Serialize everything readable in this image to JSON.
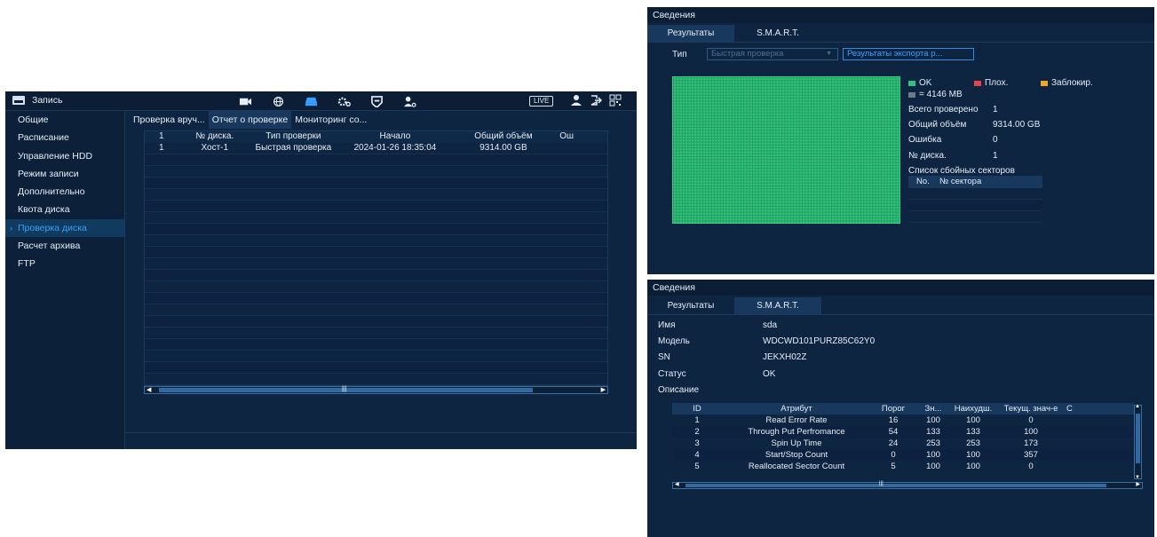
{
  "left_window": {
    "title": "Запись",
    "live_label": "LIVE",
    "sidebar": {
      "items": [
        {
          "label": "Общие",
          "active": false
        },
        {
          "label": "Расписание",
          "active": false
        },
        {
          "label": "Управление HDD",
          "active": false
        },
        {
          "label": "Режим записи",
          "active": false
        },
        {
          "label": "Дополнительно",
          "active": false
        },
        {
          "label": "Квота диска",
          "active": false
        },
        {
          "label": "Проверка диска",
          "active": true
        },
        {
          "label": "Расчет архива",
          "active": false
        },
        {
          "label": "FTP",
          "active": false
        }
      ]
    },
    "tabs": [
      {
        "label": "Проверка вруч...",
        "active": false
      },
      {
        "label": "Отчет о проверке",
        "active": true
      },
      {
        "label": "Мониторинг со...",
        "active": false
      }
    ],
    "table": {
      "headers": [
        "1",
        "№ диска.",
        "Тип проверки",
        "Начало",
        "Общий объём",
        "Ош"
      ],
      "rows": [
        [
          "1",
          "Хост-1",
          "Быстрая проверка",
          "2024-01-26 18:35:04",
          "9314.00 GB",
          ""
        ]
      ]
    },
    "icons": [
      "camera-icon",
      "network-icon",
      "storage-icon",
      "settings-icon",
      "shield-icon",
      "user-settings-icon",
      "user-icon",
      "logout-icon",
      "qr-icon"
    ]
  },
  "right_top": {
    "title": "Сведения",
    "tabs": [
      {
        "label": "Результаты",
        "active": true
      },
      {
        "label": "S.M.A.R.T.",
        "active": false
      }
    ],
    "type_label": "Тип",
    "type_value": "Быстрая проверка",
    "export_label": "Результаты экспорта р...",
    "legend": {
      "ok": "OK",
      "bad": "Плох.",
      "blocked": "Заблокир.",
      "unit": "= 4146 MB",
      "colors": {
        "ok": "#2ec57a",
        "bad": "#e8424a",
        "blocked": "#f5a623",
        "unit": "#6b7b8c"
      }
    },
    "info": [
      {
        "label": "Всего проверено",
        "value": "1"
      },
      {
        "label": "Общий объём",
        "value": "9314.00 GB"
      },
      {
        "label": "Ошибка",
        "value": "0"
      },
      {
        "label": "№ диска.",
        "value": "1"
      }
    ],
    "bad_sectors_title": "Список сбойных секторов",
    "bad_table_headers": [
      "No.",
      "№ сектора"
    ]
  },
  "right_bottom": {
    "title": "Сведения",
    "tabs": [
      {
        "label": "Результаты",
        "active": false
      },
      {
        "label": "S.M.A.R.T.",
        "active": true
      }
    ],
    "fields": [
      {
        "label": "Имя",
        "value": "sda"
      },
      {
        "label": "Модель",
        "value": "WDCWD101PURZ85C62Y0"
      },
      {
        "label": "SN",
        "value": "JEKXH02Z"
      },
      {
        "label": "Статус",
        "value": "OK"
      }
    ],
    "description_label": "Описание",
    "smart_headers": [
      "ID",
      "Атрибут",
      "Порог",
      "Зн...",
      "Наихудш.",
      "Текущ. знач-е",
      "С"
    ],
    "smart_rows": [
      [
        "1",
        "Read Error Rate",
        "16",
        "100",
        "100",
        "0"
      ],
      [
        "2",
        "Through Put Perfromance",
        "54",
        "133",
        "133",
        "100"
      ],
      [
        "3",
        "Spin Up Time",
        "24",
        "253",
        "253",
        "173"
      ],
      [
        "4",
        "Start/Stop Count",
        "0",
        "100",
        "100",
        "357"
      ],
      [
        "5",
        "Reallocated Sector Count",
        "5",
        "100",
        "100",
        "0"
      ]
    ]
  }
}
